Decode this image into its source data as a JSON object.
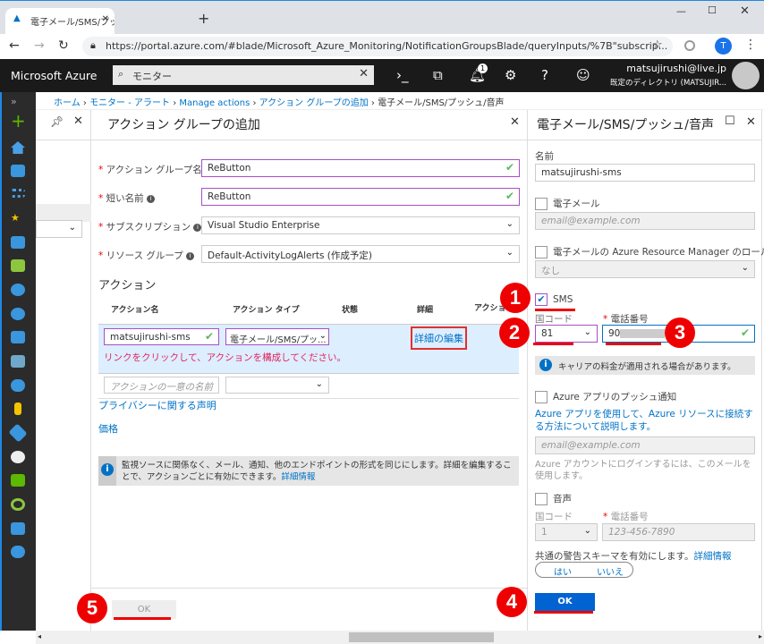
{
  "browser": {
    "tab_title": "電子メール/SMS/プッシュ/音声 - Mic",
    "new_tab": "+",
    "url": "https://portal.azure.com/#blade/Microsoft_Azure_Monitoring/NotificationGroupsBlade/queryInputs/%7B\"subscrip...",
    "profile_initial": "T"
  },
  "topbar": {
    "brand": "Microsoft Azure",
    "search_value": "モニター",
    "notification_count": "1",
    "user_email": "matsujirushi@live.jp",
    "user_directory": "既定のディレクトリ (MATSUJIR..."
  },
  "breadcrumb": [
    "ホーム",
    "モニター - アラート",
    "Manage actions",
    "アクション グループの追加",
    "電子メール/SMS/プッシュ/音声"
  ],
  "main": {
    "title": "アクション グループの追加",
    "fields": [
      {
        "label": "アクション グループ名",
        "value": "ReButton"
      },
      {
        "label": "短い名前",
        "value": "ReButton"
      },
      {
        "label": "サブスクリプション",
        "value": "Visual Studio Enterprise"
      },
      {
        "label": "リソース グループ",
        "value": "Default-ActivityLogAlerts (作成予定)"
      }
    ],
    "actions_heading": "アクション",
    "columns": [
      "アクション名",
      "アクション タイプ",
      "状態",
      "詳細",
      "アクション"
    ],
    "row": {
      "name": "matsujirushi-sms",
      "type": "電子メール/SMS/プッ...",
      "details_link": "詳細の編集",
      "error": "リンクをクリックして、アクションを構成してください。"
    },
    "new_row_placeholder": "アクションの一意の名前",
    "privacy_link": "プライバシーに関する声明",
    "pricing_link": "価格",
    "note": "監視ソースに関係なく、メール、通知、他のエンドポイントの形式を同じにします。詳細を編集することで、アクションごとに有効にできます。",
    "note_link": "詳細情報",
    "ok": "OK"
  },
  "detail": {
    "title": "電子メール/SMS/プッシュ/音声",
    "name_label": "名前",
    "name_value": "matsujirushi-sms",
    "email_label": "電子メール",
    "email_placeholder": "email@example.com",
    "arm_label": "電子メールの Azure Resource Manager のロール",
    "arm_value": "なし",
    "sms_label": "SMS",
    "sms_checked": true,
    "country_label": "国コード",
    "country_value": "81",
    "phone_label": "電話番号",
    "phone_value": "90",
    "carrier_note": "キャリアの料金が適用される場合があります。",
    "push_label": "Azure アプリのプッシュ通知",
    "push_link": "Azure アプリを使用して、Azure リソースに接続する方法について説明します。",
    "push_placeholder": "email@example.com",
    "push_help": "Azure アカウントにログインするには、このメールを使用します。",
    "voice_label": "音声",
    "voice_country_value": "1",
    "voice_phone_placeholder": "123-456-7890",
    "schema_text": "共通の警告スキーマを有効にします。",
    "schema_link": "詳細情報",
    "yes": "はい",
    "no": "いいえ",
    "ok": "OK"
  },
  "annotations": [
    "1",
    "2",
    "3",
    "4",
    "5"
  ],
  "colors": {
    "accent": "#0072c6",
    "ok_button": "#0063d1",
    "annotation": "#e00000"
  }
}
